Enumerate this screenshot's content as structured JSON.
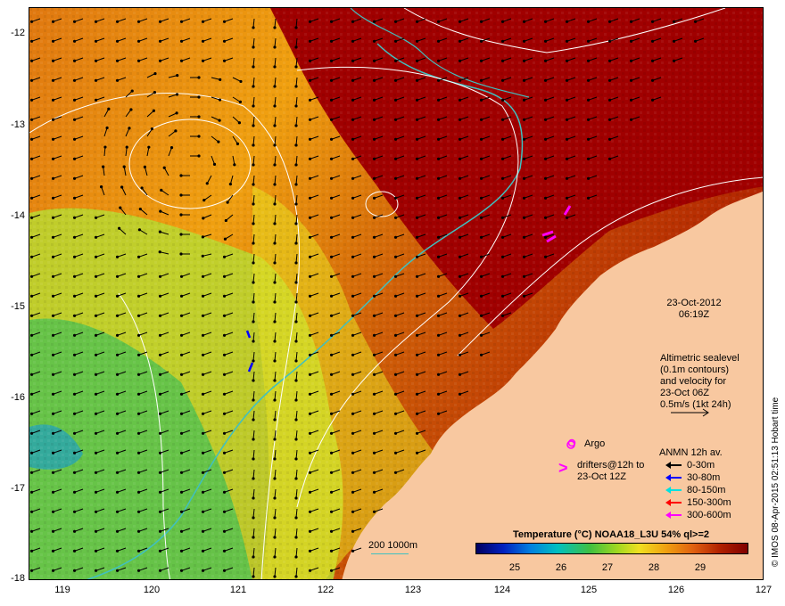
{
  "axes": {
    "y_labels": [
      "-12",
      "-13",
      "-14",
      "-15",
      "-16",
      "-17",
      "-18"
    ],
    "x_labels": [
      "119",
      "120",
      "121",
      "122",
      "123",
      "124",
      "125",
      "126",
      "127"
    ],
    "lon_range": [
      118.6,
      127
    ],
    "lat_range": [
      -12,
      -18
    ]
  },
  "annotation": {
    "date": "23-Oct-2012",
    "time": "06:19Z",
    "altimetry_lines": [
      "Altimetric sealevel",
      "(0.1m contours)",
      "and velocity for",
      "23-Oct 06Z",
      "0.5m/s (1kt 24h)"
    ],
    "argo_label": "Argo",
    "drifters_lines": [
      "drifters@12h to",
      "23-Oct 12Z"
    ],
    "drifter_symbol": ">",
    "isobath_label": "200  1000m"
  },
  "anmn_legend": {
    "title": "ANMN 12h av.",
    "items": [
      {
        "label": "0-30m",
        "color": "#000000"
      },
      {
        "label": "30-80m",
        "color": "#0000ff"
      },
      {
        "label": "80-150m",
        "color": "#00e0e0"
      },
      {
        "label": "150-300m",
        "color": "#ff0000"
      },
      {
        "label": "300-600m",
        "color": "#ff00ff"
      }
    ]
  },
  "colorbar": {
    "title": "Temperature (°C) NOAA18_L3U 54% ql>=2",
    "ticks": [
      "25",
      "26",
      "27",
      "28",
      "29"
    ]
  },
  "credit": "© IMOS 08-Apr-2015 02:51:13 Hobart time",
  "colors": {
    "land": "#f8c8a0",
    "hot_sea": "#a00000",
    "isobath": "#40c0c0",
    "contour": "#ffffff",
    "argo": "#ff00ff"
  }
}
